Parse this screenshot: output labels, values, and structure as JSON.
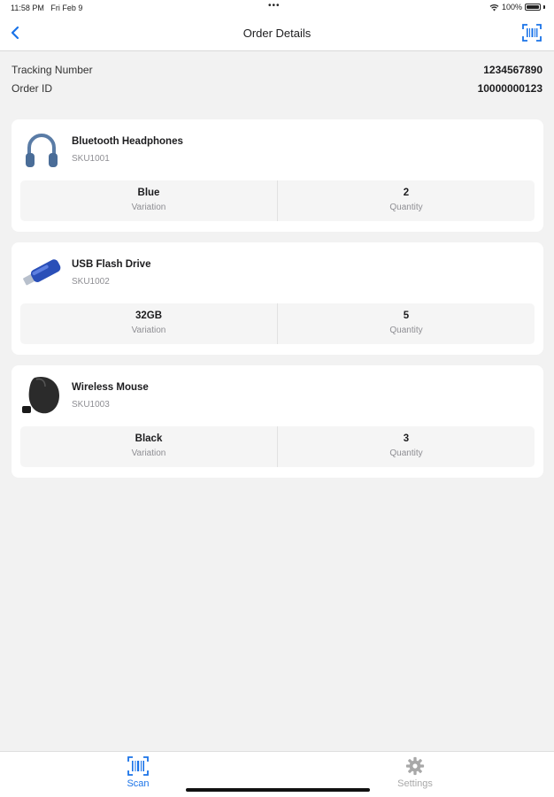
{
  "status": {
    "time": "11:58 PM",
    "date": "Fri Feb 9",
    "dots": "•••",
    "battery": "100%"
  },
  "nav": {
    "title": "Order Details",
    "back_icon": "chevron-left-icon",
    "scan_icon": "barcode-scan-icon",
    "accent": "#1a73e8"
  },
  "order": {
    "tracking_label": "Tracking Number",
    "tracking_value": "1234567890",
    "id_label": "Order ID",
    "id_value": "10000000123"
  },
  "items": [
    {
      "name": "Bluetooth Headphones",
      "sku": "SKU1001",
      "variation": "Blue",
      "variation_label": "Variation",
      "quantity": "2",
      "quantity_label": "Quantity",
      "image": "headphones"
    },
    {
      "name": "USB Flash Drive",
      "sku": "SKU1002",
      "variation": "32GB",
      "variation_label": "Variation",
      "quantity": "5",
      "quantity_label": "Quantity",
      "image": "usb-drive"
    },
    {
      "name": "Wireless Mouse",
      "sku": "SKU1003",
      "variation": "Black",
      "variation_label": "Variation",
      "quantity": "3",
      "quantity_label": "Quantity",
      "image": "mouse"
    }
  ],
  "tabs": [
    {
      "label": "Scan",
      "icon": "barcode-scan-icon",
      "active": true
    },
    {
      "label": "Settings",
      "icon": "gear-icon",
      "active": false
    }
  ]
}
